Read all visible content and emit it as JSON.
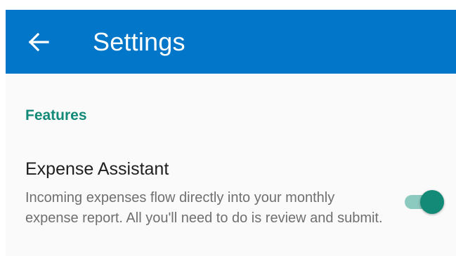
{
  "app_bar": {
    "back_icon": "arrow-left-icon",
    "title": "Settings",
    "background_color": "#0276c8"
  },
  "features_section": {
    "header": "Features",
    "header_color": "#138a77",
    "settings": [
      {
        "title": "Expense Assistant",
        "description": "Incoming expenses flow directly into your monthly expense report. All you'll need to do is review and submit.",
        "toggle_on": true,
        "toggle_color": "#138a77"
      }
    ]
  }
}
